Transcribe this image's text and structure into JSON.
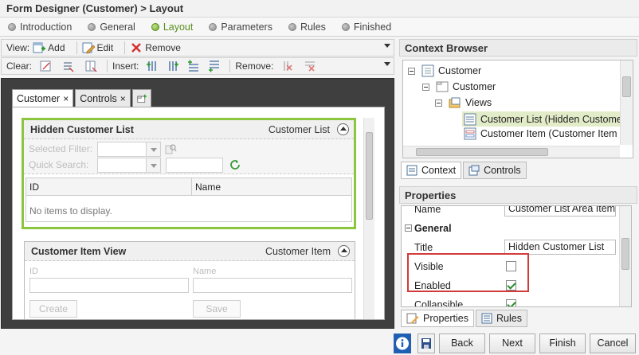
{
  "window": {
    "title": "Form Designer (Customer) > Layout"
  },
  "steps": [
    "Introduction",
    "General",
    "Layout",
    "Parameters",
    "Rules",
    "Finished"
  ],
  "active_step": "Layout",
  "toolbar1": {
    "view_label": "View:",
    "add": "Add",
    "edit": "Edit",
    "remove": "Remove"
  },
  "toolbar2": {
    "clear_label": "Clear:",
    "insert_label": "Insert:",
    "remove_label": "Remove:"
  },
  "form_tabs": [
    {
      "label": "Customer",
      "close": "×"
    },
    {
      "label": "Controls",
      "close": "×"
    }
  ],
  "view1": {
    "title": "Hidden Customer List",
    "type": "Customer List",
    "selected_filter": "Selected Filter:",
    "quick_search": "Quick Search:",
    "col_id": "ID",
    "col_name": "Name",
    "empty": "No items to display."
  },
  "view2": {
    "title": "Customer Item View",
    "type": "Customer Item",
    "id_label": "ID",
    "name_label": "Name",
    "create": "Create",
    "save": "Save"
  },
  "context_browser": {
    "title": "Context Browser",
    "tree": [
      "Customer",
      "Customer",
      "Views",
      "Customer List (Hidden Customer",
      "Customer Item (Customer Item"
    ],
    "tabs": [
      "Context",
      "Controls"
    ]
  },
  "properties": {
    "title": "Properties",
    "name_row_label": "Name",
    "name_row_value": "Customer List Area Item",
    "section": "General",
    "title_label": "Title",
    "title_value": "Hidden Customer List",
    "visible_label": "Visible",
    "visible": false,
    "enabled_label": "Enabled",
    "enabled": true,
    "collapsible_label": "Collapsible",
    "collapsible": true,
    "tabs": [
      "Properties",
      "Rules"
    ]
  },
  "footer": {
    "back": "Back",
    "next": "Next",
    "finish": "Finish",
    "cancel": "Cancel"
  }
}
